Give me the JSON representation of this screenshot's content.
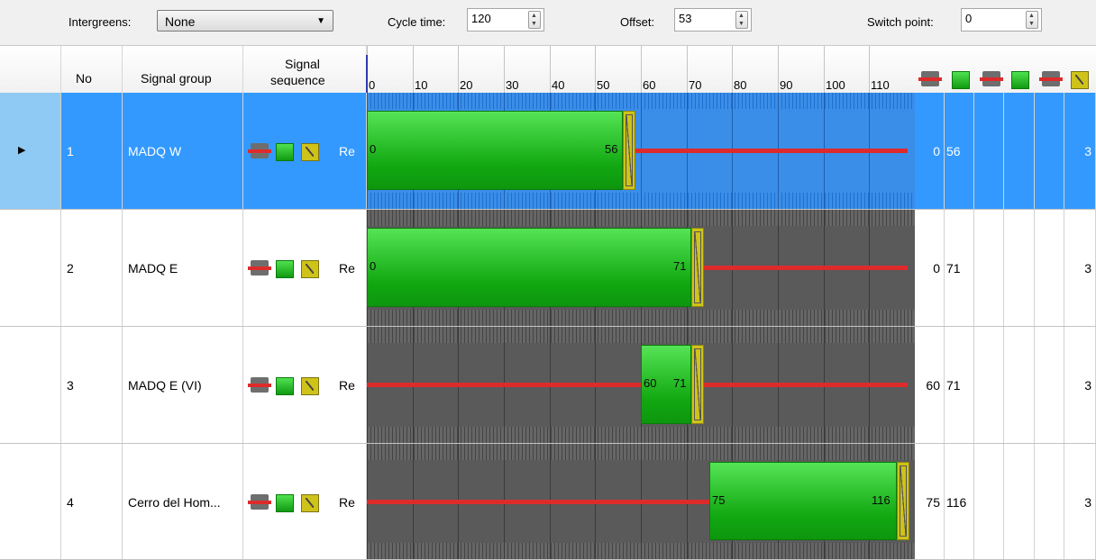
{
  "toolbar": {
    "intergreens_label": "Intergreens:",
    "intergreens_value": "None",
    "cycle_time_label": "Cycle time:",
    "cycle_time_value": "120",
    "offset_label": "Offset:",
    "offset_value": "53",
    "switch_point_label": "Switch point:",
    "switch_point_value": "0"
  },
  "columns": {
    "no": "No",
    "signal_group": "Signal group",
    "signal_sequence_line1": "Signal",
    "signal_sequence_line2": "sequence",
    "tick_labels": [
      "0",
      "10",
      "20",
      "30",
      "40",
      "50",
      "60",
      "70",
      "80",
      "90",
      "100",
      "110"
    ]
  },
  "rows": [
    {
      "no": "1",
      "name": "MADQ W",
      "seq": "Re",
      "green_start": 0,
      "green_end": 56,
      "start_label": "0",
      "end_label": "56",
      "col_a": "0",
      "col_b": "56",
      "col_last": "3",
      "selected": true
    },
    {
      "no": "2",
      "name": "MADQ E",
      "seq": "Re",
      "green_start": 0,
      "green_end": 71,
      "start_label": "0",
      "end_label": "71",
      "col_a": "0",
      "col_b": "71",
      "col_last": "3",
      "selected": false
    },
    {
      "no": "3",
      "name": "MADQ E (VI)",
      "seq": "Re",
      "green_start": 60,
      "green_end": 71,
      "start_label": "60",
      "end_label": "71",
      "col_a": "60",
      "col_b": "71",
      "col_last": "3",
      "selected": false
    },
    {
      "no": "4",
      "name": "Cerro del Hom...",
      "seq": "Re",
      "green_start": 75,
      "green_end": 116,
      "start_label": "75",
      "end_label": "116",
      "col_a": "75",
      "col_b": "116",
      "col_last": "3",
      "selected": false
    }
  ],
  "colors": {
    "selection": "#3399ff",
    "green": "#22c022",
    "red": "#dd2b2b",
    "amber": "#cfc31a",
    "timeline_bg": "#5a5a5a"
  }
}
